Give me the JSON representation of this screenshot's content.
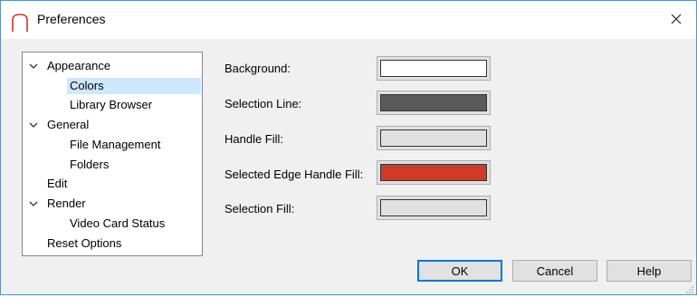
{
  "window": {
    "title": "Preferences",
    "close_glyph": "✕"
  },
  "tree": {
    "items": [
      {
        "label": "Appearance",
        "level": 0,
        "expanded": true
      },
      {
        "label": "Colors",
        "level": 1,
        "selected": true
      },
      {
        "label": "Library Browser",
        "level": 1
      },
      {
        "label": "General",
        "level": 0,
        "expanded": true
      },
      {
        "label": "File Management",
        "level": 1
      },
      {
        "label": "Folders",
        "level": 1
      },
      {
        "label": "Edit",
        "level": 0
      },
      {
        "label": "Render",
        "level": 0,
        "expanded": true
      },
      {
        "label": "Video Card Status",
        "level": 1
      },
      {
        "label": "Reset Options",
        "level": 0
      }
    ]
  },
  "colors": {
    "fields": [
      {
        "label": "Background:",
        "color": "#ffffff"
      },
      {
        "label": "Selection Line:",
        "color": "#5a5a5a"
      },
      {
        "label": "Handle Fill:",
        "color": "#e0e0e0"
      },
      {
        "label": "Selected Edge Handle Fill:",
        "color": "#d03a28"
      },
      {
        "label": "Selection Fill:",
        "color": "#e0e0e0"
      }
    ]
  },
  "buttons": {
    "ok": "OK",
    "cancel": "Cancel",
    "help": "Help"
  },
  "theme": {
    "accent": "#0078d7",
    "selection": "#cce8ff",
    "window_border": "#5a8fc8",
    "app_icon_color": "#c0392b"
  },
  "icons": {
    "app": "arch-app-icon",
    "close": "close-icon",
    "expand": "chevron-down-icon",
    "resize": "resize-grip-icon"
  }
}
